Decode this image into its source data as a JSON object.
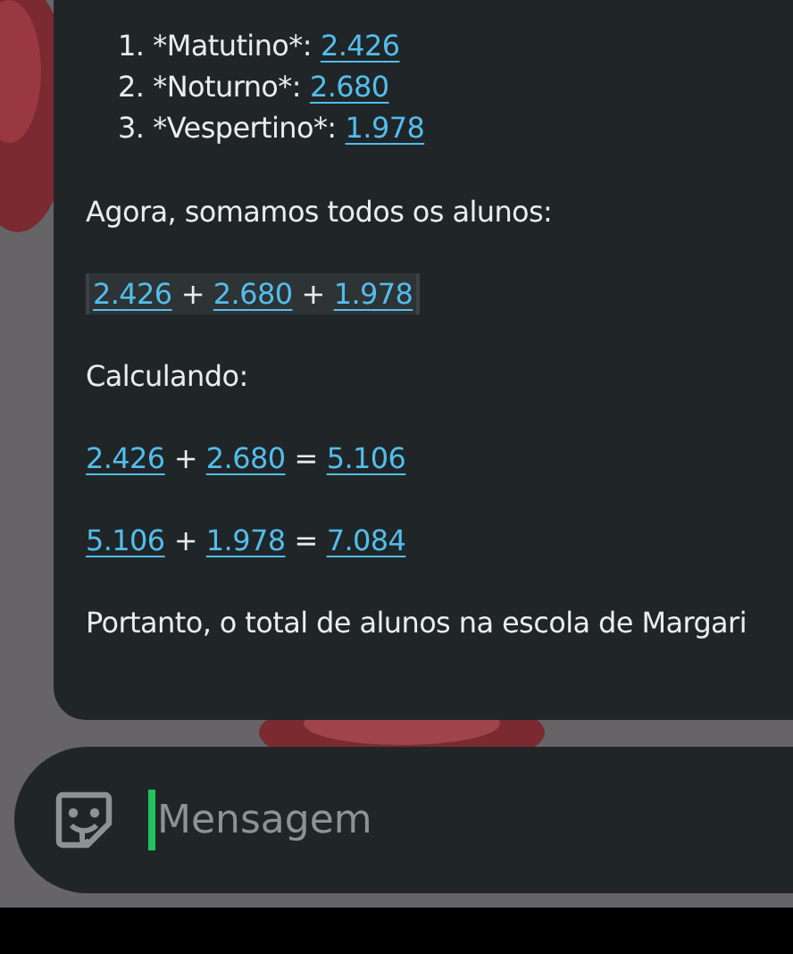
{
  "message": {
    "list": [
      {
        "number": "1.",
        "label": "*Matutino*:",
        "value": "2.426"
      },
      {
        "number": "2.",
        "label": "*Noturno*:",
        "value": "2.680"
      },
      {
        "number": "3.",
        "label": "*Vespertino*:",
        "value": "1.978"
      }
    ],
    "blocks": [
      {
        "kind": "text",
        "text": "Agora, somamos todos os alunos:"
      },
      {
        "kind": "expression",
        "boxed": true,
        "tokens": [
          {
            "kind": "number",
            "text": "2.426"
          },
          {
            "kind": "operator",
            "text": "+"
          },
          {
            "kind": "number",
            "text": "2.680"
          },
          {
            "kind": "operator",
            "text": "+"
          },
          {
            "kind": "number",
            "text": "1.978"
          }
        ]
      },
      {
        "kind": "text",
        "text": "Calculando:"
      },
      {
        "kind": "expression",
        "boxed": false,
        "tokens": [
          {
            "kind": "number",
            "text": "2.426"
          },
          {
            "kind": "operator",
            "text": "+"
          },
          {
            "kind": "number",
            "text": "2.680"
          },
          {
            "kind": "operator",
            "text": "="
          },
          {
            "kind": "number",
            "text": "5.106"
          }
        ]
      },
      {
        "kind": "expression",
        "boxed": false,
        "tokens": [
          {
            "kind": "number",
            "text": "5.106"
          },
          {
            "kind": "operator",
            "text": "+"
          },
          {
            "kind": "number",
            "text": "1.978"
          },
          {
            "kind": "operator",
            "text": "="
          },
          {
            "kind": "number",
            "text": "7.084"
          }
        ]
      },
      {
        "kind": "text",
        "text": "Portanto, o total de alunos na escola de Margari"
      }
    ]
  },
  "composer": {
    "placeholder": "Mensagem"
  }
}
